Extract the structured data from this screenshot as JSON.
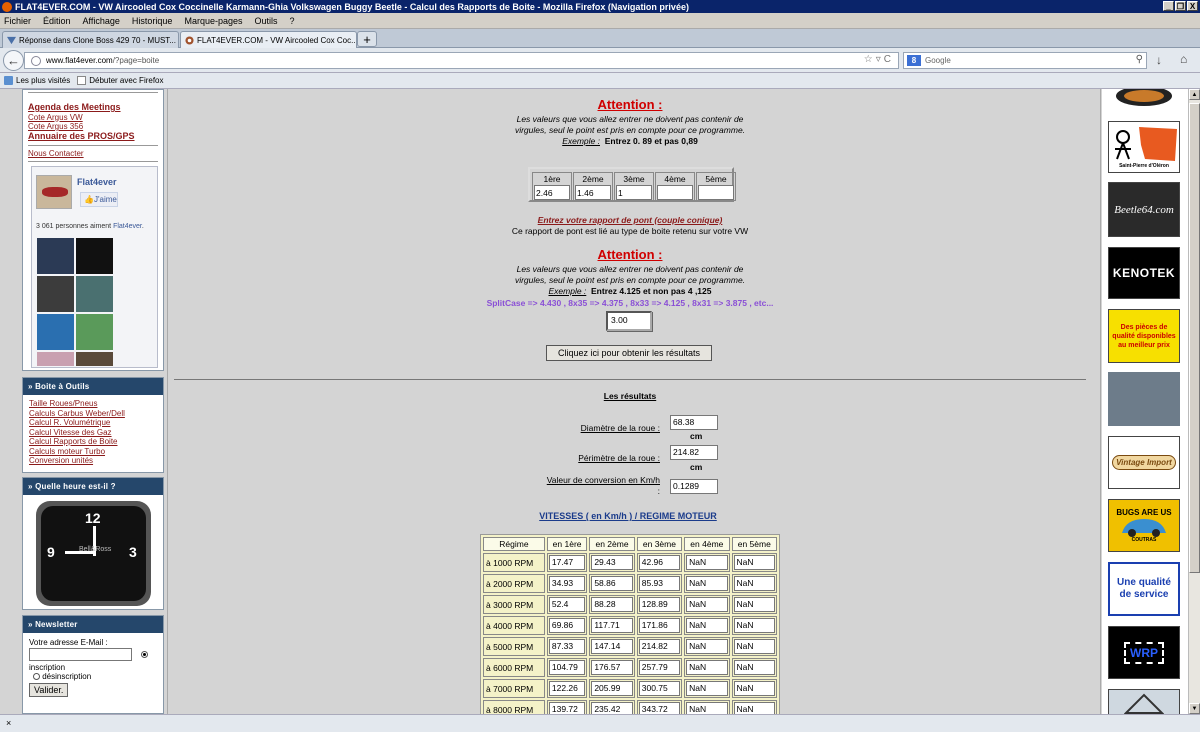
{
  "window": {
    "title": "FLAT4EVER.COM - VW Aircooled Cox Coccinelle Karmann-Ghia Volkswagen Buggy Beetle - Calcul des Rapports de Boite - Mozilla Firefox (Navigation privée)",
    "controls": [
      "_",
      "❒",
      "X"
    ]
  },
  "menu": [
    "Fichier",
    "Édition",
    "Affichage",
    "Historique",
    "Marque-pages",
    "Outils",
    "?"
  ],
  "tabs": [
    {
      "label": "Réponse dans Clone Boss 429 70 - MUST...",
      "close": "×"
    },
    {
      "label": "FLAT4EVER.COM - VW Aircooled Cox Coc...",
      "close": "×"
    }
  ],
  "newtab": "+",
  "url": {
    "domain": "www.flat4ever.com",
    "path": "/?page=boite"
  },
  "search": {
    "placeholder": "Google",
    "engine": "8"
  },
  "bookmarks": [
    "Les plus visités",
    "Débuter avec Firefox"
  ],
  "status": "×",
  "left": {
    "top_links": [
      "Agenda des Meetings",
      "Cote Argus VW",
      "Cote Argus 356",
      "Annuaire des PROS/GPS"
    ],
    "contact": "Nous Contacter",
    "facebook": {
      "name": "Flat4ever",
      "like": "J'aime",
      "count_prefix": "3 061 personnes aiment ",
      "count_name": "Flat4ever",
      "count_suffix": "."
    },
    "tools": {
      "title": "» Boite à Outils",
      "links": [
        "Taille Roues/Pneus",
        "Calculs Carbus Weber/Dell",
        "Calcul R. Volumétrique",
        "Calcul Vitesse des Gaz",
        "Calcul Rapports de Boite",
        "Calculs moteur Turbo",
        "Conversion unités"
      ]
    },
    "clock": {
      "title": "» Quelle heure est-il ?"
    },
    "newsletter": {
      "title": "» Newsletter",
      "email_label": "Votre adresse E-Mail :",
      "sub": "inscription",
      "unsub": "désinscription",
      "button": "Valider."
    }
  },
  "main": {
    "attention": "Attention :",
    "warn1": {
      "line1": "Les valeurs que vous allez entrer ne doivent pas contenir de",
      "line2": "virgules, seul le point est pris en compte pour ce programme.",
      "ex": "Exemple :",
      "example": "Entrez 0. 89 et pas 0,89"
    },
    "gear_headers": [
      "1ère",
      "2ème",
      "3ème",
      "4ème",
      "5ème"
    ],
    "gear_values": [
      "2.46",
      "1.46",
      "1",
      "",
      ""
    ],
    "pont_title": "Entrez votre rapport de pont (couple conique)",
    "pont_note": "Ce rapport de pont est lié au type de boite retenu sur votre VW",
    "warn2": {
      "line1": "Les valeurs que vous allez entrer ne doivent pas contenir de",
      "line2": "virgules, seul le point est pris en compte pour ce programme.",
      "ex": "Exemple :",
      "example": "Entrez 4.125 et non pas 4 ,125"
    },
    "splitcase": "SplitCase => 4.430 , 8x35 => 4.375 , 8x33 => 4.125 , 8x31 => 3.875 , etc...",
    "pont_value": "3.00",
    "button": "Cliquez ici pour obtenir les résultats",
    "results_title": "Les résultats",
    "diam_label": "Diamètre de la roue :",
    "diam_value": "68.38",
    "peri_label": "Périmètre de la roue :",
    "peri_value": "214.82",
    "unit": "cm",
    "conv_label": "Valeur de conversion en Km/h",
    "conv_colon": ":",
    "conv_value": "0.1289",
    "speeds_title": "VITESSES ( en Km/h ) / REGIME MOTEUR",
    "table_headers": [
      "Régime",
      "en 1ère",
      "en 2ème",
      "en 3ème",
      "en 4ème",
      "en 5ème"
    ],
    "table_rows": [
      [
        "à 1000 RPM",
        "17.47",
        "29.43",
        "42.96",
        "NaN",
        "NaN"
      ],
      [
        "à 2000 RPM",
        "34.93",
        "58.86",
        "85.93",
        "NaN",
        "NaN"
      ],
      [
        "à 3000 RPM",
        "52.4",
        "88.28",
        "128.89",
        "NaN",
        "NaN"
      ],
      [
        "à 4000 RPM",
        "69.86",
        "117.71",
        "171.86",
        "NaN",
        "NaN"
      ],
      [
        "à 5000 RPM",
        "87.33",
        "147.14",
        "214.82",
        "NaN",
        "NaN"
      ],
      [
        "à 6000 RPM",
        "104.79",
        "176.57",
        "257.79",
        "NaN",
        "NaN"
      ],
      [
        "à 7000 RPM",
        "122.26",
        "205.99",
        "300.75",
        "NaN",
        "NaN"
      ],
      [
        "à 8000 RPM",
        "139.72",
        "235.42",
        "343.72",
        "NaN",
        "NaN"
      ]
    ]
  },
  "right_ads": {
    "oleron": "Saint-Pierre d'Oléron",
    "beetle": "Beetle64.com",
    "kenotek": "KENOTEK",
    "pieces": "Des pièces de qualité disponibles au meilleur prix",
    "vintage": "Vintage Import",
    "bugs": "BUGS ARE US",
    "bugs_sub": "COUTRAS",
    "qualite": "Une qualité de service",
    "wrp": "WRP"
  },
  "colors": {
    "accent_red": "#d00000",
    "link": "#8b1a1a",
    "box_header": "#25476b",
    "splitcase": "#8a4fd6",
    "speeds": "#1a3b8b"
  }
}
